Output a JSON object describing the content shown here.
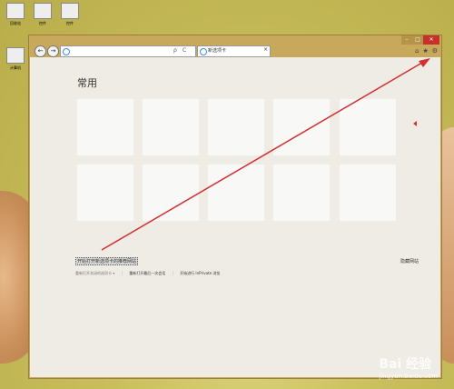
{
  "desktop": {
    "icons": [
      {
        "label": "回收站",
        "icon": "recycle-bin-icon"
      },
      {
        "label": "控件",
        "icon": "control-icon"
      },
      {
        "label": "控件",
        "icon": "control-icon"
      },
      {
        "label": "计算机",
        "icon": "computer-icon"
      }
    ]
  },
  "browser": {
    "address": {
      "value": "",
      "search_glyph": "ρ",
      "refresh_glyph": "C"
    },
    "tab": {
      "title": "新选项卡",
      "close": "×"
    },
    "nav": {
      "back": "←",
      "forward": "→"
    },
    "window_controls": {
      "minimize": "–",
      "maximize": "□",
      "close": "✕"
    },
    "tools": {
      "home": "⌂",
      "favorites": "★",
      "settings": "⚙"
    }
  },
  "new_tab_page": {
    "section_title": "常用",
    "tile_count": 10,
    "recommend_label": "开始打开新选项卡的推荐网站",
    "hide_sites": "隐藏网站",
    "links": {
      "reopen_closed": "重新打开关闭的选项卡 ▾",
      "reopen_last": "重新打开最后一次会话",
      "inprivate": "开始进行 InPrivate 浏览"
    }
  },
  "annotation": {
    "arrow_color": "#d32f2f"
  },
  "watermark": {
    "brand": "Bai 经验",
    "url": "jingyan.baidu.com"
  }
}
